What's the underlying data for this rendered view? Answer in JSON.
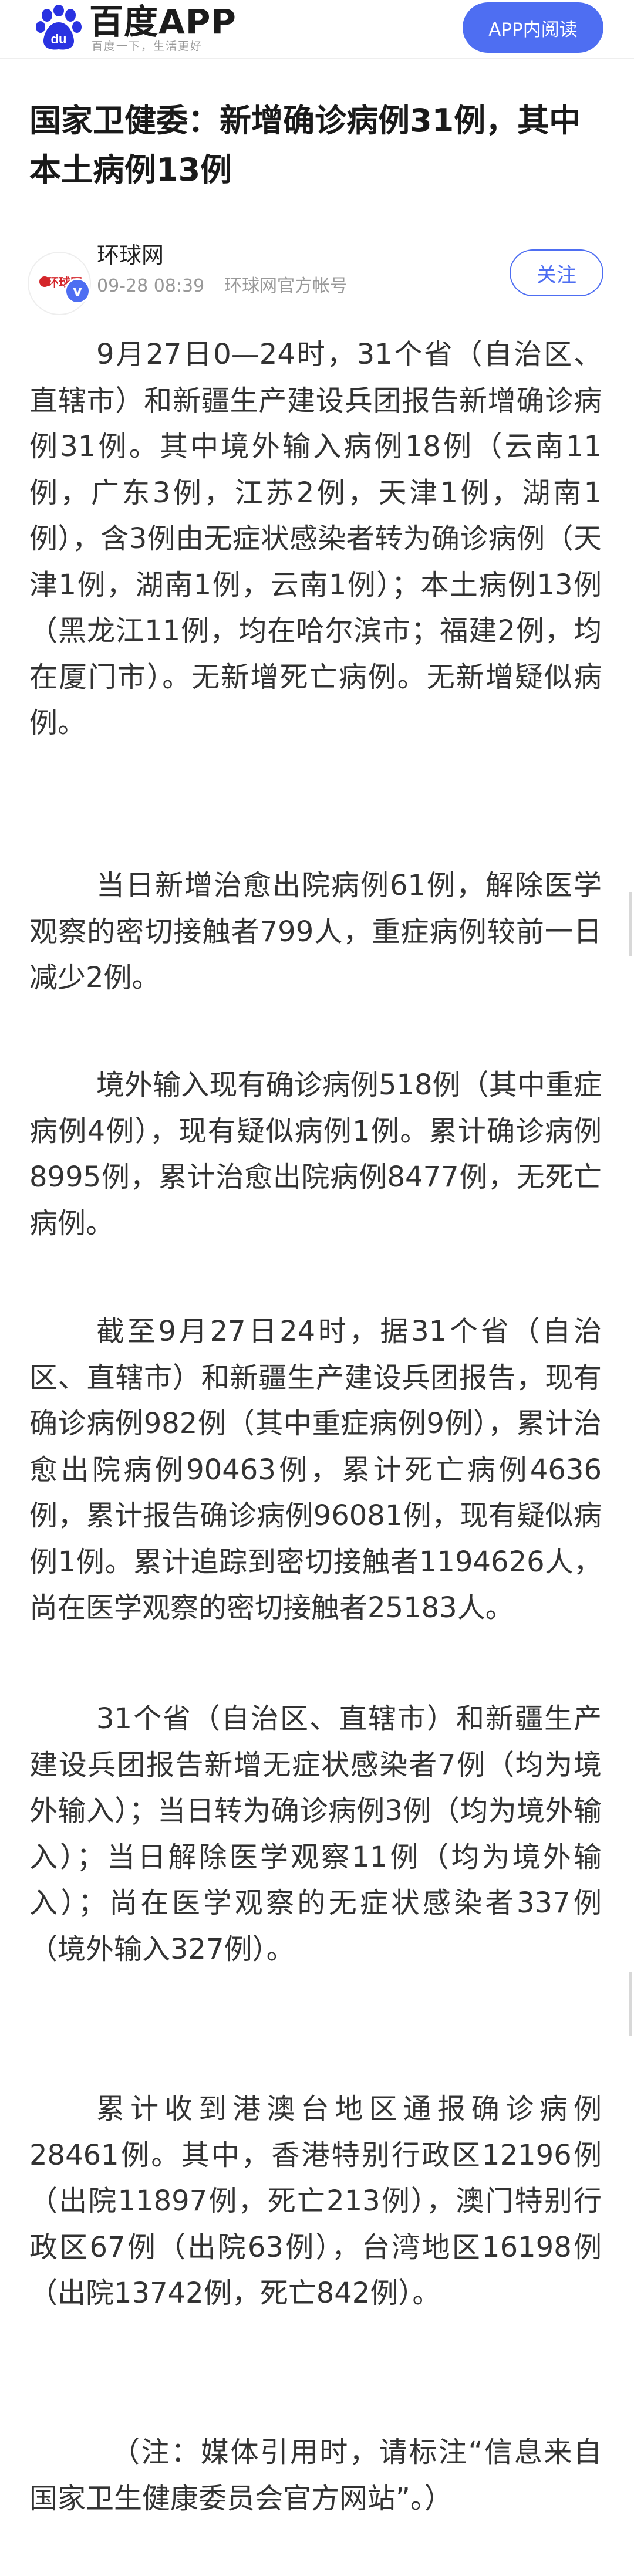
{
  "header": {
    "app_name": "百度APP",
    "slogan": "百度一下，生活更好",
    "open_in_app_label": "APP内阅读",
    "logo_icon": "baidu-paw-icon",
    "logo_text": "du",
    "accent_color": "#4e6ef2"
  },
  "article": {
    "title": "国家卫健委：新增确诊病例31例，其中本土病例13例",
    "source": {
      "name": "环球网",
      "avatar_text": "环球网",
      "date": "09-28 08:39",
      "description": "环球网官方帐号",
      "follow_label": "关注"
    },
    "paragraphs": [
      "9月27日0—24时，31个省（自治区、直辖市）和新疆生产建设兵团报告新增确诊病例31例。其中境外输入病例18例（云南11例，广东3例，江苏2例，天津1例，湖南1例），含3例由无症状感染者转为确诊病例（天津1例，湖南1例，云南1例）；本土病例13例（黑龙江11例，均在哈尔滨市；福建2例，均在厦门市）。无新增死亡病例。无新增疑似病例。",
      "当日新增治愈出院病例61例，解除医学观察的密切接触者799人，重症病例较前一日减少2例。",
      "境外输入现有确诊病例518例（其中重症病例4例），现有疑似病例1例。累计确诊病例8995例，累计治愈出院病例8477例，无死亡病例。",
      "截至9月27日24时，据31个省（自治区、直辖市）和新疆生产建设兵团报告，现有确诊病例982例（其中重症病例9例），累计治愈出院病例90463例，累计死亡病例4636例，累计报告确诊病例96081例，现有疑似病例1例。累计追踪到密切接触者1194626人，尚在医学观察的密切接触者25183人。",
      "31个省（自治区、直辖市）和新疆生产建设兵团报告新增无症状感染者7例（均为境外输入）；当日转为确诊病例3例（均为境外输入）；当日解除医学观察11例（均为境外输入）；尚在医学观察的无症状感染者337例（境外输入327例）。",
      "累计收到港澳台地区通报确诊病例28461例。其中，香港特别行政区12196例（出院11897例，死亡213例），澳门特别行政区67例（出院63例），台湾地区16198例（出院13742例，死亡842例）。",
      "（注：媒体引用时，请标注“信息来自国家卫生健康委员会官方网站”。）"
    ]
  }
}
